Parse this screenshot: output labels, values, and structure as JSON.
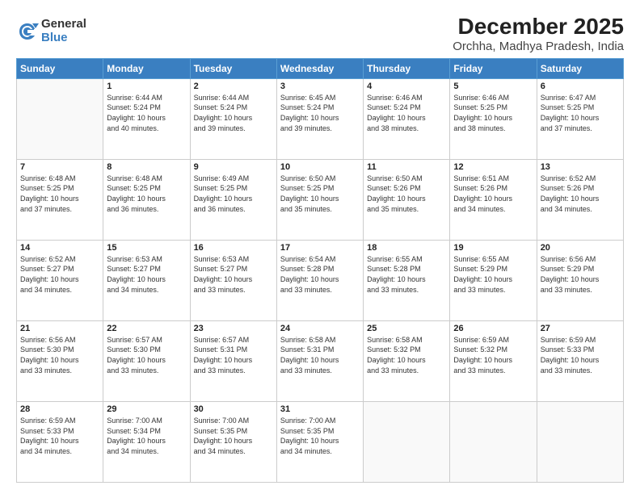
{
  "logo": {
    "general": "General",
    "blue": "Blue"
  },
  "title": "December 2025",
  "location": "Orchha, Madhya Pradesh, India",
  "header_days": [
    "Sunday",
    "Monday",
    "Tuesday",
    "Wednesday",
    "Thursday",
    "Friday",
    "Saturday"
  ],
  "weeks": [
    [
      {
        "day": "",
        "info": ""
      },
      {
        "day": "1",
        "info": "Sunrise: 6:44 AM\nSunset: 5:24 PM\nDaylight: 10 hours\nand 40 minutes."
      },
      {
        "day": "2",
        "info": "Sunrise: 6:44 AM\nSunset: 5:24 PM\nDaylight: 10 hours\nand 39 minutes."
      },
      {
        "day": "3",
        "info": "Sunrise: 6:45 AM\nSunset: 5:24 PM\nDaylight: 10 hours\nand 39 minutes."
      },
      {
        "day": "4",
        "info": "Sunrise: 6:46 AM\nSunset: 5:24 PM\nDaylight: 10 hours\nand 38 minutes."
      },
      {
        "day": "5",
        "info": "Sunrise: 6:46 AM\nSunset: 5:25 PM\nDaylight: 10 hours\nand 38 minutes."
      },
      {
        "day": "6",
        "info": "Sunrise: 6:47 AM\nSunset: 5:25 PM\nDaylight: 10 hours\nand 37 minutes."
      }
    ],
    [
      {
        "day": "7",
        "info": "Sunrise: 6:48 AM\nSunset: 5:25 PM\nDaylight: 10 hours\nand 37 minutes."
      },
      {
        "day": "8",
        "info": "Sunrise: 6:48 AM\nSunset: 5:25 PM\nDaylight: 10 hours\nand 36 minutes."
      },
      {
        "day": "9",
        "info": "Sunrise: 6:49 AM\nSunset: 5:25 PM\nDaylight: 10 hours\nand 36 minutes."
      },
      {
        "day": "10",
        "info": "Sunrise: 6:50 AM\nSunset: 5:25 PM\nDaylight: 10 hours\nand 35 minutes."
      },
      {
        "day": "11",
        "info": "Sunrise: 6:50 AM\nSunset: 5:26 PM\nDaylight: 10 hours\nand 35 minutes."
      },
      {
        "day": "12",
        "info": "Sunrise: 6:51 AM\nSunset: 5:26 PM\nDaylight: 10 hours\nand 34 minutes."
      },
      {
        "day": "13",
        "info": "Sunrise: 6:52 AM\nSunset: 5:26 PM\nDaylight: 10 hours\nand 34 minutes."
      }
    ],
    [
      {
        "day": "14",
        "info": "Sunrise: 6:52 AM\nSunset: 5:27 PM\nDaylight: 10 hours\nand 34 minutes."
      },
      {
        "day": "15",
        "info": "Sunrise: 6:53 AM\nSunset: 5:27 PM\nDaylight: 10 hours\nand 34 minutes."
      },
      {
        "day": "16",
        "info": "Sunrise: 6:53 AM\nSunset: 5:27 PM\nDaylight: 10 hours\nand 33 minutes."
      },
      {
        "day": "17",
        "info": "Sunrise: 6:54 AM\nSunset: 5:28 PM\nDaylight: 10 hours\nand 33 minutes."
      },
      {
        "day": "18",
        "info": "Sunrise: 6:55 AM\nSunset: 5:28 PM\nDaylight: 10 hours\nand 33 minutes."
      },
      {
        "day": "19",
        "info": "Sunrise: 6:55 AM\nSunset: 5:29 PM\nDaylight: 10 hours\nand 33 minutes."
      },
      {
        "day": "20",
        "info": "Sunrise: 6:56 AM\nSunset: 5:29 PM\nDaylight: 10 hours\nand 33 minutes."
      }
    ],
    [
      {
        "day": "21",
        "info": "Sunrise: 6:56 AM\nSunset: 5:30 PM\nDaylight: 10 hours\nand 33 minutes."
      },
      {
        "day": "22",
        "info": "Sunrise: 6:57 AM\nSunset: 5:30 PM\nDaylight: 10 hours\nand 33 minutes."
      },
      {
        "day": "23",
        "info": "Sunrise: 6:57 AM\nSunset: 5:31 PM\nDaylight: 10 hours\nand 33 minutes."
      },
      {
        "day": "24",
        "info": "Sunrise: 6:58 AM\nSunset: 5:31 PM\nDaylight: 10 hours\nand 33 minutes."
      },
      {
        "day": "25",
        "info": "Sunrise: 6:58 AM\nSunset: 5:32 PM\nDaylight: 10 hours\nand 33 minutes."
      },
      {
        "day": "26",
        "info": "Sunrise: 6:59 AM\nSunset: 5:32 PM\nDaylight: 10 hours\nand 33 minutes."
      },
      {
        "day": "27",
        "info": "Sunrise: 6:59 AM\nSunset: 5:33 PM\nDaylight: 10 hours\nand 33 minutes."
      }
    ],
    [
      {
        "day": "28",
        "info": "Sunrise: 6:59 AM\nSunset: 5:33 PM\nDaylight: 10 hours\nand 34 minutes."
      },
      {
        "day": "29",
        "info": "Sunrise: 7:00 AM\nSunset: 5:34 PM\nDaylight: 10 hours\nand 34 minutes."
      },
      {
        "day": "30",
        "info": "Sunrise: 7:00 AM\nSunset: 5:35 PM\nDaylight: 10 hours\nand 34 minutes."
      },
      {
        "day": "31",
        "info": "Sunrise: 7:00 AM\nSunset: 5:35 PM\nDaylight: 10 hours\nand 34 minutes."
      },
      {
        "day": "",
        "info": ""
      },
      {
        "day": "",
        "info": ""
      },
      {
        "day": "",
        "info": ""
      }
    ]
  ]
}
